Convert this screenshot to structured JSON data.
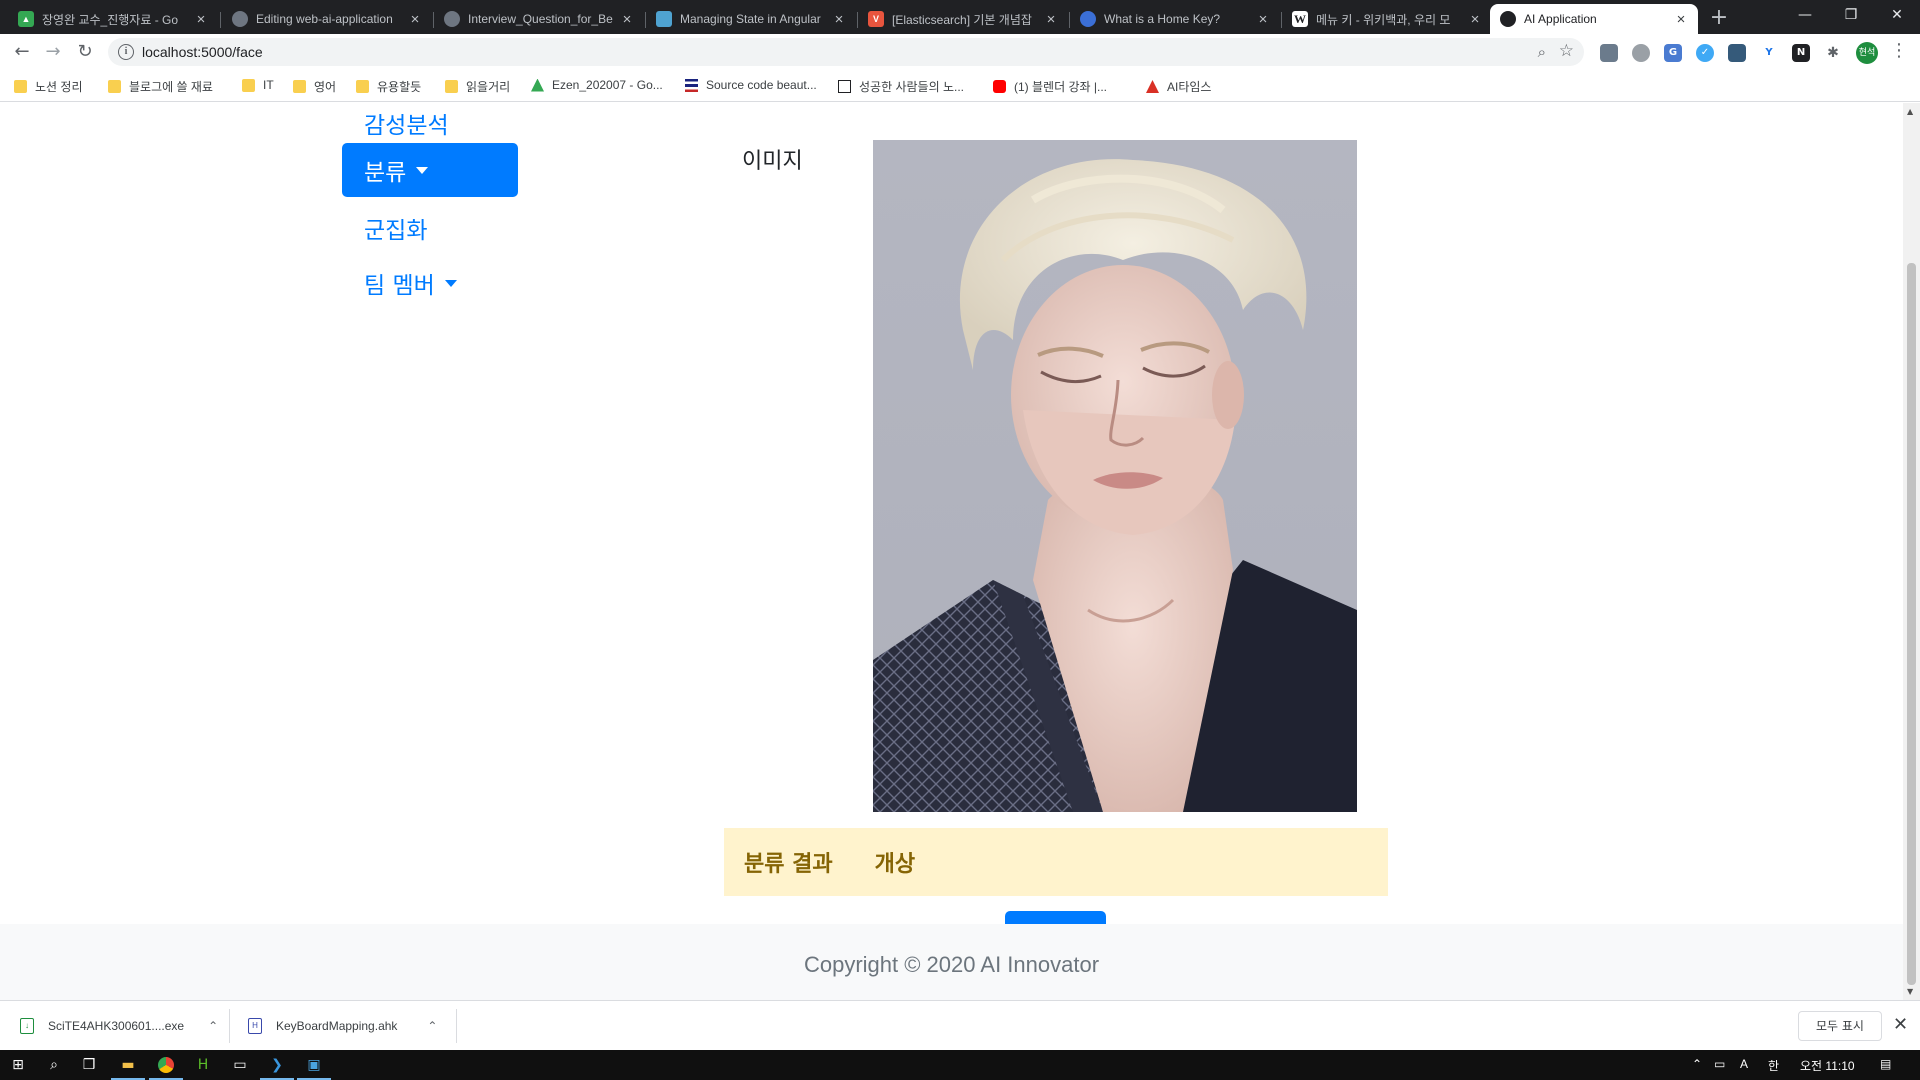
{
  "browser": {
    "tabs": [
      {
        "title": "장영완 교수_진행자료 - Go",
        "icon": "google-drive-icon",
        "color": "#34a853"
      },
      {
        "title": "Editing web-ai-application",
        "icon": "github-icon",
        "color": "#6e7681"
      },
      {
        "title": "Interview_Question_for_Be",
        "icon": "github-icon",
        "color": "#6e7681"
      },
      {
        "title": "Managing State in Angular",
        "icon": "web-page-icon",
        "color": "#4fa3d1"
      },
      {
        "title": "[Elasticsearch] 기본 개념잡",
        "icon": "velog-icon",
        "color": "#e8553e"
      },
      {
        "title": "What is a Home Key?",
        "icon": "web-page-icon",
        "color": "#3b6fd6"
      },
      {
        "title": "메뉴 키 - 위키백과, 우리 모",
        "icon": "wikipedia-icon",
        "color": "#ffffff"
      },
      {
        "title": "AI Application",
        "icon": "ai-app-icon",
        "color": "#202124"
      }
    ],
    "new_tab": "+",
    "window_controls": {
      "minimize": "—",
      "restore": "❐",
      "close": "✕"
    },
    "nav": {
      "back": "←",
      "forward": "→",
      "reload": "↻"
    },
    "url": "localhost:5000/face",
    "profile_initials": "현석",
    "bookmarks": [
      {
        "label": "노션 정리",
        "icon": "folder-icon"
      },
      {
        "label": "블로그에 쓸 재료",
        "icon": "folder-icon"
      },
      {
        "label": "IT",
        "icon": "folder-icon"
      },
      {
        "label": "영어",
        "icon": "folder-icon"
      },
      {
        "label": "유용할듯",
        "icon": "folder-icon"
      },
      {
        "label": "읽을거리",
        "icon": "folder-icon"
      },
      {
        "label": "Ezen_202007 - Go...",
        "icon": "google-drive-icon"
      },
      {
        "label": "Source code beaut...",
        "icon": "list-icon"
      },
      {
        "label": "성공한 사람들의 노...",
        "icon": "notion-icon"
      },
      {
        "label": "(1) 블렌더 강좌 |...",
        "icon": "youtube-icon"
      },
      {
        "label": "AI타임스",
        "icon": "aitimes-icon"
      }
    ]
  },
  "page": {
    "sidebar": [
      {
        "label": "감성분석",
        "active": false,
        "dropdown": false
      },
      {
        "label": "분류",
        "active": true,
        "dropdown": true
      },
      {
        "label": "군집화",
        "active": false,
        "dropdown": false
      },
      {
        "label": "팀 멤버",
        "active": false,
        "dropdown": true
      }
    ],
    "image_label": "이미지",
    "result": {
      "label": "분류 결과",
      "value": "개상"
    },
    "footer": "Copyright © 2020 AI Innovator"
  },
  "downloads": {
    "items": [
      {
        "name": "SciTE4AHK300601....exe",
        "icon": "installer-icon"
      },
      {
        "name": "KeyBoardMapping.ahk",
        "icon": "ahk-file-icon"
      }
    ],
    "show_all": "모두 표시",
    "close": "✕"
  },
  "taskbar": {
    "clock": "오전 11:10",
    "ime": "A",
    "ime_mode": "한"
  },
  "colors": {
    "primary": "#007bff",
    "alert_bg": "#fff3cd",
    "alert_text": "#856404",
    "footer_bg": "#f8f9fa"
  }
}
